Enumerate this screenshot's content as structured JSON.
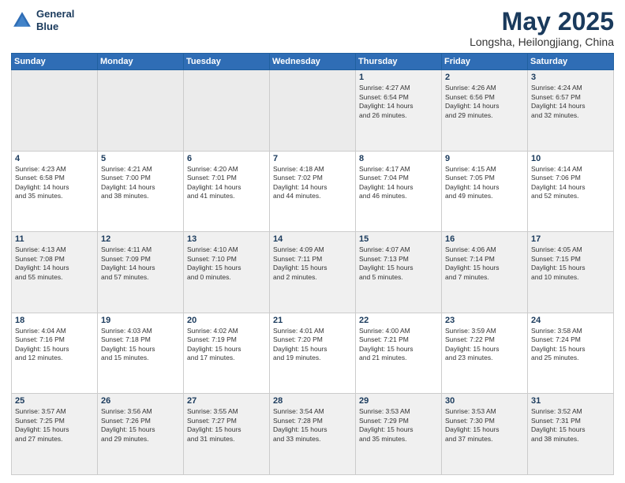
{
  "header": {
    "logo_line1": "General",
    "logo_line2": "Blue",
    "month": "May 2025",
    "location": "Longsha, Heilongjiang, China"
  },
  "weekdays": [
    "Sunday",
    "Monday",
    "Tuesday",
    "Wednesday",
    "Thursday",
    "Friday",
    "Saturday"
  ],
  "weeks": [
    [
      {
        "day": "",
        "empty": true
      },
      {
        "day": "",
        "empty": true
      },
      {
        "day": "",
        "empty": true
      },
      {
        "day": "",
        "empty": true
      },
      {
        "day": "1",
        "info": "Sunrise: 4:27 AM\nSunset: 6:54 PM\nDaylight: 14 hours\nand 26 minutes."
      },
      {
        "day": "2",
        "info": "Sunrise: 4:26 AM\nSunset: 6:56 PM\nDaylight: 14 hours\nand 29 minutes."
      },
      {
        "day": "3",
        "info": "Sunrise: 4:24 AM\nSunset: 6:57 PM\nDaylight: 14 hours\nand 32 minutes."
      }
    ],
    [
      {
        "day": "4",
        "info": "Sunrise: 4:23 AM\nSunset: 6:58 PM\nDaylight: 14 hours\nand 35 minutes."
      },
      {
        "day": "5",
        "info": "Sunrise: 4:21 AM\nSunset: 7:00 PM\nDaylight: 14 hours\nand 38 minutes."
      },
      {
        "day": "6",
        "info": "Sunrise: 4:20 AM\nSunset: 7:01 PM\nDaylight: 14 hours\nand 41 minutes."
      },
      {
        "day": "7",
        "info": "Sunrise: 4:18 AM\nSunset: 7:02 PM\nDaylight: 14 hours\nand 44 minutes."
      },
      {
        "day": "8",
        "info": "Sunrise: 4:17 AM\nSunset: 7:04 PM\nDaylight: 14 hours\nand 46 minutes."
      },
      {
        "day": "9",
        "info": "Sunrise: 4:15 AM\nSunset: 7:05 PM\nDaylight: 14 hours\nand 49 minutes."
      },
      {
        "day": "10",
        "info": "Sunrise: 4:14 AM\nSunset: 7:06 PM\nDaylight: 14 hours\nand 52 minutes."
      }
    ],
    [
      {
        "day": "11",
        "info": "Sunrise: 4:13 AM\nSunset: 7:08 PM\nDaylight: 14 hours\nand 55 minutes."
      },
      {
        "day": "12",
        "info": "Sunrise: 4:11 AM\nSunset: 7:09 PM\nDaylight: 14 hours\nand 57 minutes."
      },
      {
        "day": "13",
        "info": "Sunrise: 4:10 AM\nSunset: 7:10 PM\nDaylight: 15 hours\nand 0 minutes."
      },
      {
        "day": "14",
        "info": "Sunrise: 4:09 AM\nSunset: 7:11 PM\nDaylight: 15 hours\nand 2 minutes."
      },
      {
        "day": "15",
        "info": "Sunrise: 4:07 AM\nSunset: 7:13 PM\nDaylight: 15 hours\nand 5 minutes."
      },
      {
        "day": "16",
        "info": "Sunrise: 4:06 AM\nSunset: 7:14 PM\nDaylight: 15 hours\nand 7 minutes."
      },
      {
        "day": "17",
        "info": "Sunrise: 4:05 AM\nSunset: 7:15 PM\nDaylight: 15 hours\nand 10 minutes."
      }
    ],
    [
      {
        "day": "18",
        "info": "Sunrise: 4:04 AM\nSunset: 7:16 PM\nDaylight: 15 hours\nand 12 minutes."
      },
      {
        "day": "19",
        "info": "Sunrise: 4:03 AM\nSunset: 7:18 PM\nDaylight: 15 hours\nand 15 minutes."
      },
      {
        "day": "20",
        "info": "Sunrise: 4:02 AM\nSunset: 7:19 PM\nDaylight: 15 hours\nand 17 minutes."
      },
      {
        "day": "21",
        "info": "Sunrise: 4:01 AM\nSunset: 7:20 PM\nDaylight: 15 hours\nand 19 minutes."
      },
      {
        "day": "22",
        "info": "Sunrise: 4:00 AM\nSunset: 7:21 PM\nDaylight: 15 hours\nand 21 minutes."
      },
      {
        "day": "23",
        "info": "Sunrise: 3:59 AM\nSunset: 7:22 PM\nDaylight: 15 hours\nand 23 minutes."
      },
      {
        "day": "24",
        "info": "Sunrise: 3:58 AM\nSunset: 7:24 PM\nDaylight: 15 hours\nand 25 minutes."
      }
    ],
    [
      {
        "day": "25",
        "info": "Sunrise: 3:57 AM\nSunset: 7:25 PM\nDaylight: 15 hours\nand 27 minutes."
      },
      {
        "day": "26",
        "info": "Sunrise: 3:56 AM\nSunset: 7:26 PM\nDaylight: 15 hours\nand 29 minutes."
      },
      {
        "day": "27",
        "info": "Sunrise: 3:55 AM\nSunset: 7:27 PM\nDaylight: 15 hours\nand 31 minutes."
      },
      {
        "day": "28",
        "info": "Sunrise: 3:54 AM\nSunset: 7:28 PM\nDaylight: 15 hours\nand 33 minutes."
      },
      {
        "day": "29",
        "info": "Sunrise: 3:53 AM\nSunset: 7:29 PM\nDaylight: 15 hours\nand 35 minutes."
      },
      {
        "day": "30",
        "info": "Sunrise: 3:53 AM\nSunset: 7:30 PM\nDaylight: 15 hours\nand 37 minutes."
      },
      {
        "day": "31",
        "info": "Sunrise: 3:52 AM\nSunset: 7:31 PM\nDaylight: 15 hours\nand 38 minutes."
      }
    ]
  ]
}
